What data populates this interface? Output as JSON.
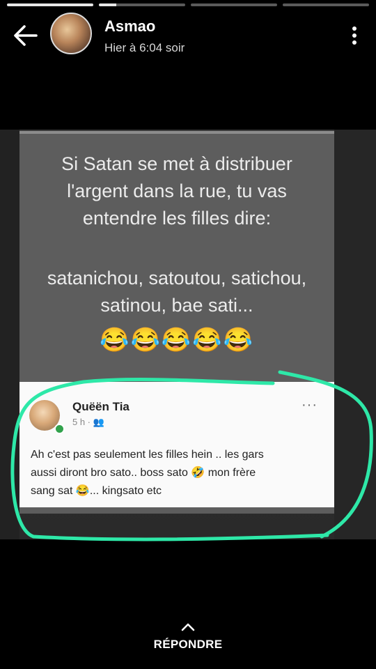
{
  "progress": [
    1.0,
    0.2,
    0.0,
    0.0
  ],
  "header": {
    "name": "Asmao",
    "time": "Hier à 6:04 soir",
    "back_icon": "arrow-left-icon",
    "menu_icon": "more-vertical-icon"
  },
  "meme": {
    "line1": "Si Satan se met à distribuer",
    "line2": "l'argent dans la rue, tu vas",
    "line3": "entendre les filles dire:",
    "line4": "satanichou, satoutou, satichou,",
    "line5": "satinou, bae sati...",
    "emojis": "😂😂😂😂😂"
  },
  "comment": {
    "name": "Quëën Tia",
    "time": "5 h · 👥",
    "more": "···",
    "line1": "Ah c'est pas seulement les filles hein .. les gars",
    "line2": "aussi diront bro sato.. boss sato 🤣 mon frère",
    "line3": "sang sat 😂... kingsato etc"
  },
  "colors": {
    "highlight": "#2ee8a8",
    "background": "#000000",
    "online": "#31a24c"
  },
  "reply": {
    "label": "RÉPONDRE",
    "icon": "chevron-up-icon"
  }
}
